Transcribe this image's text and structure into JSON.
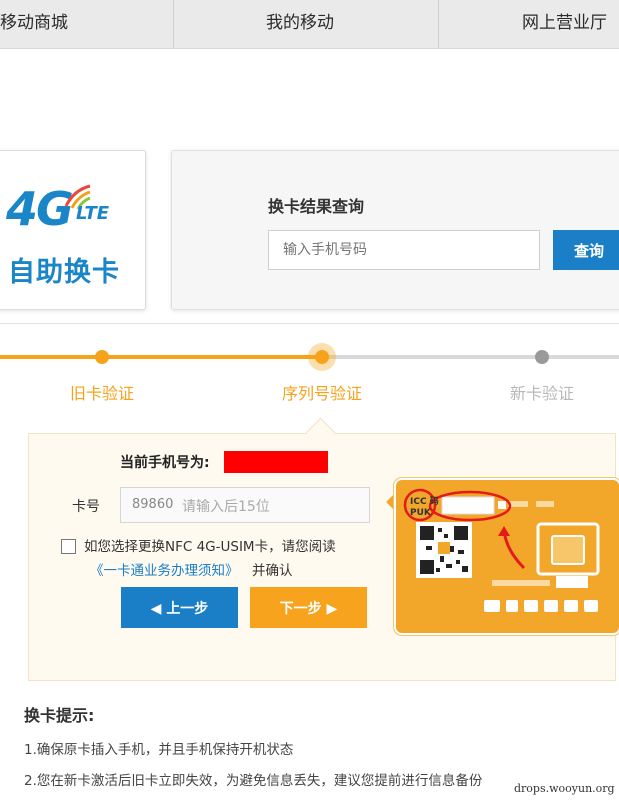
{
  "nav": {
    "items": [
      "移动商城",
      "我的移动",
      "网上营业厅"
    ]
  },
  "logo": {
    "badge": "4G",
    "badge_suffix": "LTE",
    "text": "自助换卡"
  },
  "query": {
    "title": "换卡结果查询",
    "phone_placeholder": "输入手机号码",
    "button_label": "查询"
  },
  "steps": [
    {
      "label": "旧卡验证",
      "state": "done"
    },
    {
      "label": "序列号验证",
      "state": "current"
    },
    {
      "label": "新卡验证",
      "state": "todo"
    }
  ],
  "form": {
    "current_phone_label": "当前手机号为:",
    "card_label": "卡号",
    "card_prefix": "89860",
    "card_placeholder": "请输入后15位",
    "nfc_text_1": "如您选择更换NFC 4G-USIM卡，请您阅读",
    "nfc_link": "《一卡通业务办理须知》",
    "nfc_text_2": "并确认",
    "prev_button": "上一步",
    "next_button": "下一步"
  },
  "sim_image": {
    "icc_label": "ICC 码",
    "puk_label": "PUK"
  },
  "tips": {
    "title": "换卡提示:",
    "items": [
      "1.确保原卡插入手机，并且手机保持开机状态",
      "2.您在新卡激活后旧卡立即失效，为避免信息丢失，建议您提前进行信息备份"
    ]
  },
  "watermark": "drops.wooyun.org",
  "colors": {
    "accent_blue": "#1a7fc6",
    "accent_orange": "#f7a21b",
    "redaction": "#ff0000"
  }
}
